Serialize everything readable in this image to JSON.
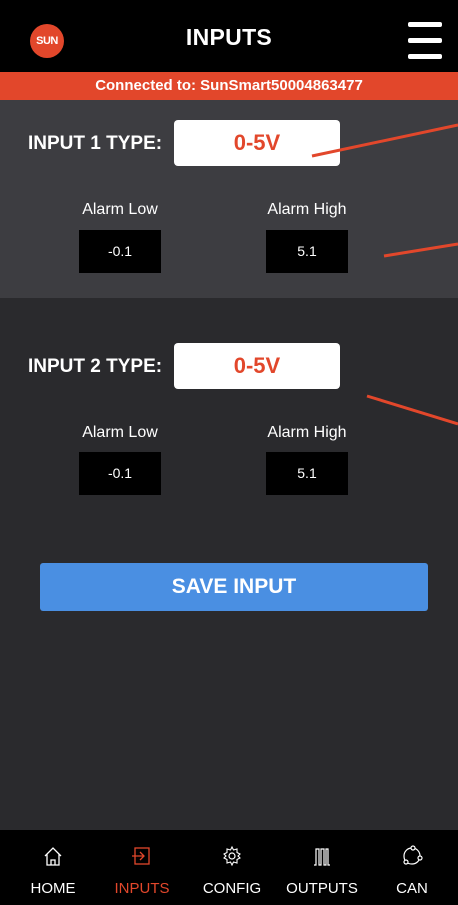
{
  "header": {
    "logo_text": "SUN",
    "title": "INPUTS",
    "menu_icon": "hamburger-icon"
  },
  "connection": {
    "text": "Connected to: SunSmart50004863477"
  },
  "input1": {
    "type_label": "INPUT 1 TYPE:",
    "type_value": "0-5V",
    "alarm_low_label": "Alarm Low",
    "alarm_low_value": "-0.1",
    "alarm_high_label": "Alarm High",
    "alarm_high_value": "5.1"
  },
  "input2": {
    "type_label": "INPUT 2 TYPE:",
    "type_value": "0-5V",
    "alarm_low_label": "Alarm Low",
    "alarm_low_value": "-0.1",
    "alarm_high_label": "Alarm High",
    "alarm_high_value": "5.1"
  },
  "save_button": {
    "label": "SAVE INPUT"
  },
  "nav": {
    "items": [
      {
        "label": "HOME",
        "icon": "home-icon"
      },
      {
        "label": "INPUTS",
        "icon": "inputs-icon",
        "active": true
      },
      {
        "label": "CONFIG",
        "icon": "gear-icon"
      },
      {
        "label": "OUTPUTS",
        "icon": "outputs-icon"
      },
      {
        "label": "CAN",
        "icon": "can-network-icon"
      }
    ]
  },
  "colors": {
    "accent": "#e2472b",
    "header_bg": "#000000",
    "section1_bg": "#3d3d41",
    "section2_bg": "#2a2a2d",
    "button_blue": "#4a8fe2"
  }
}
